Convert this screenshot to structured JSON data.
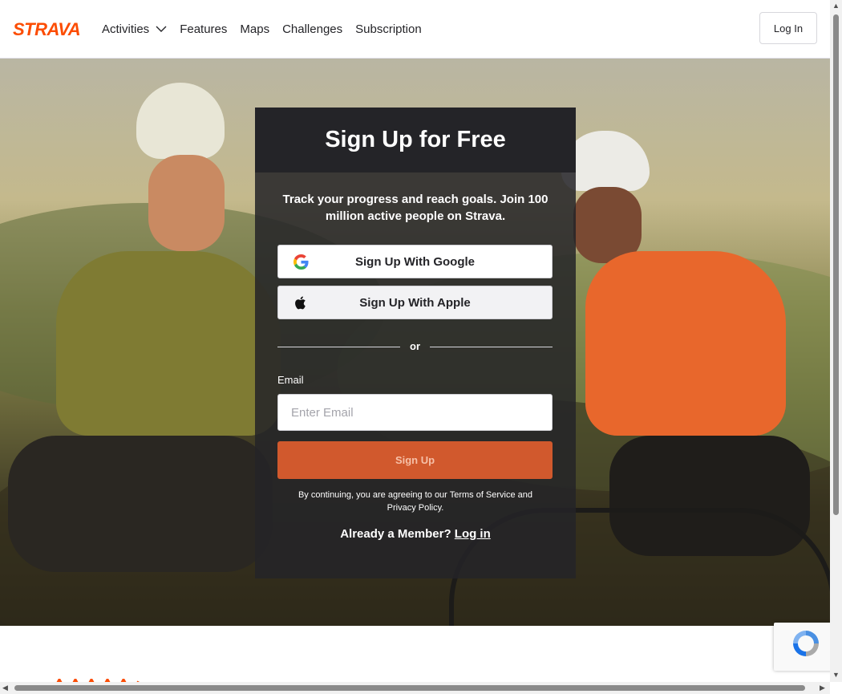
{
  "header": {
    "logo_text": "STRAVA",
    "nav": [
      {
        "label": "Activities",
        "has_dropdown": true
      },
      {
        "label": "Features"
      },
      {
        "label": "Maps"
      },
      {
        "label": "Challenges"
      },
      {
        "label": "Subscription"
      }
    ],
    "login_label": "Log In"
  },
  "signup": {
    "title": "Sign Up for Free",
    "subtitle": "Track your progress and reach goals. Join 100 million active people on Strava.",
    "google_label": "Sign Up With Google",
    "apple_label": "Sign Up With Apple",
    "or_text": "or",
    "email_label": "Email",
    "email_placeholder": "Enter Email",
    "signup_button": "Sign Up",
    "terms_prefix": "By continuing, you are agreeing to our ",
    "terms_link": "Terms of Service",
    "terms_mid": " and ",
    "privacy_link": "Privacy Policy",
    "terms_suffix": ".",
    "already_text": "Already a Member? ",
    "login_link": "Log in"
  },
  "colors": {
    "brand": "#fc4c02",
    "signup_button": "#d1592d",
    "card_header": "#242428"
  },
  "icons": [
    "chevron-down-icon",
    "google-icon",
    "apple-icon",
    "recaptcha-icon"
  ]
}
